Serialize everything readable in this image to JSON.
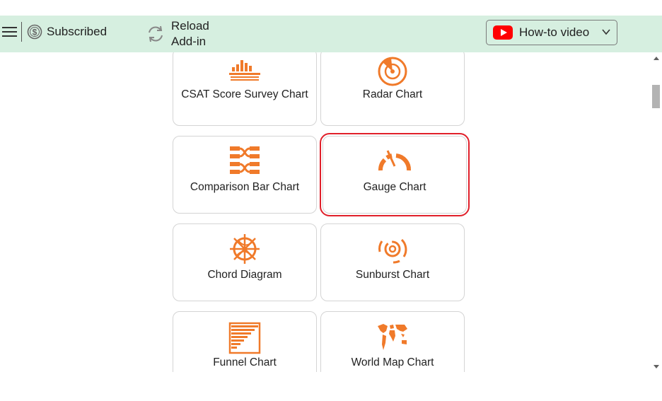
{
  "toolbar": {
    "menu_icon": "hamburger-menu-icon",
    "subscription_label": "Subscribed",
    "subscription_icon": "dollar-circle-icon",
    "reload_label": "Reload Add-in",
    "reload_icon": "refresh-icon",
    "howto_label": "How-to video",
    "howto_icon": "youtube-icon",
    "howto_chevron": "chevron-down-icon"
  },
  "accent_color": "#f07a2a",
  "selection_color": "#e0202a",
  "toolbar_color": "#d6efe0",
  "charts": [
    {
      "label": "CSAT Score Survey Chart",
      "icon": "csat-chart-icon",
      "selected": false
    },
    {
      "label": "Radar Chart",
      "icon": "radar-chart-icon",
      "selected": false
    },
    {
      "label": "Comparison Bar Chart",
      "icon": "comparison-bar-chart-icon",
      "selected": false
    },
    {
      "label": "Gauge Chart",
      "icon": "gauge-chart-icon",
      "selected": true
    },
    {
      "label": "Chord Diagram",
      "icon": "chord-diagram-icon",
      "selected": false
    },
    {
      "label": "Sunburst Chart",
      "icon": "sunburst-chart-icon",
      "selected": false
    },
    {
      "label": "Funnel Chart",
      "icon": "funnel-chart-icon",
      "selected": false
    },
    {
      "label": "World Map Chart",
      "icon": "world-map-chart-icon",
      "selected": false
    }
  ]
}
